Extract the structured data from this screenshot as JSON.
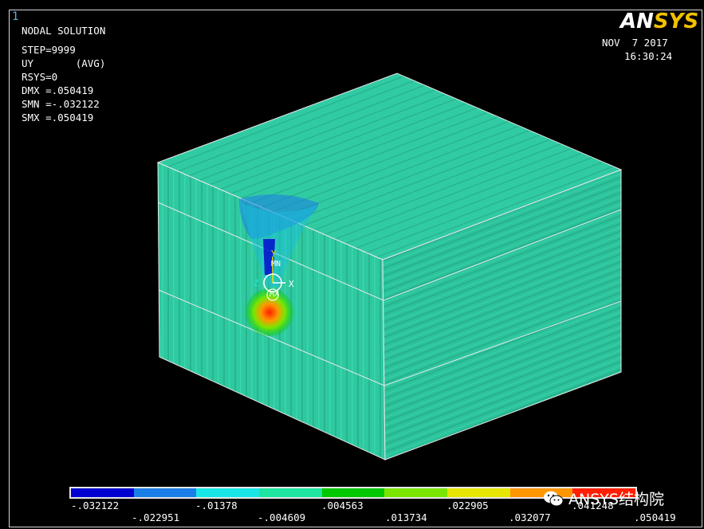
{
  "window": {
    "number": "1"
  },
  "logo": {
    "part1": "AN",
    "part2": "SYS"
  },
  "info": {
    "title": "NODAL SOLUTION",
    "step": "STEP=9999",
    "uy": "UY       (AVG)",
    "rsys": "RSYS=0",
    "dmx": "DMX =.050419",
    "smn": "SMN =-.032122",
    "smx": "SMX =.050419"
  },
  "datetime": {
    "date": "NOV  7 2017",
    "time": "16:30:24"
  },
  "triad": {
    "y": "Y",
    "x": "X",
    "z": "Z",
    "mn": "MN",
    "mx": "MX"
  },
  "legend": {
    "colors": [
      "#0000d0",
      "#1a7ee8",
      "#19e6e6",
      "#1ee6a0",
      "#00c800",
      "#7ae600",
      "#e6e600",
      "#ff9600",
      "#ff1e00"
    ],
    "labels_top": [
      ".032122",
      "-.01378",
      ".004563",
      ".022905",
      ".041248"
    ],
    "labels_top_raw": [
      "-.032122",
      "-.01378",
      ".004563",
      ".022905",
      ".041248"
    ],
    "labels_bottom": [
      "-.022951",
      "-.004609",
      ".013734",
      ".032077",
      ".050419"
    ]
  },
  "watermark": {
    "text": "ANSYS结构院",
    "icon": "wechat-icon"
  },
  "model": {
    "body_color": "#2fc9a0"
  }
}
